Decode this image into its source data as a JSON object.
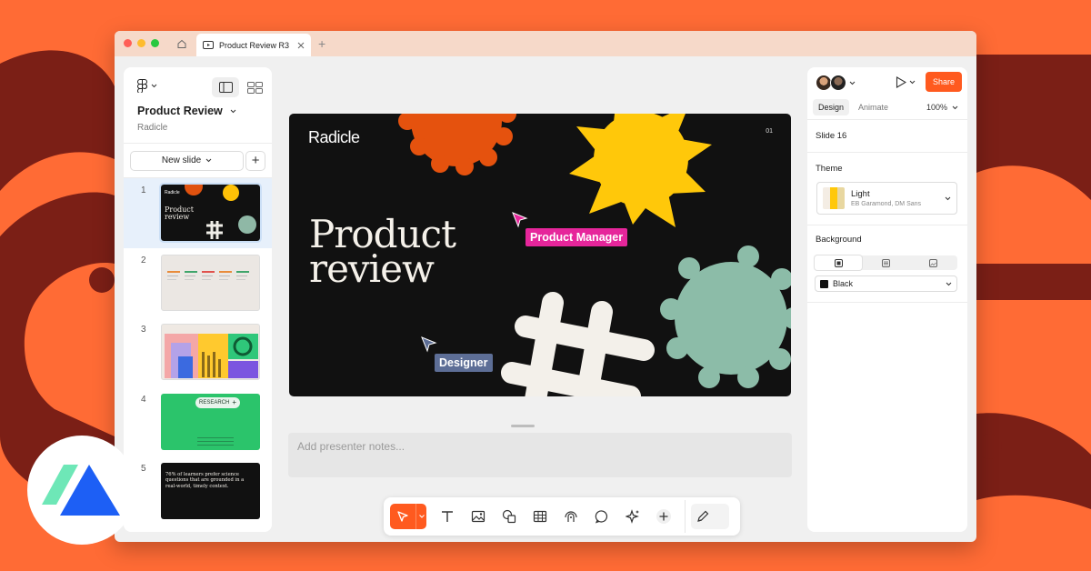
{
  "colors": {
    "background": "#ff6b35",
    "background_shape": "#7b1f16",
    "accent": "#ff5a1f",
    "slide_bg": "#111111",
    "label_product_manager": "#e6269b",
    "label_designer": "#5d6e96"
  },
  "browser": {
    "tab_title": "Product Review R3",
    "tab_icon": "slides-icon",
    "new_tab_label": "+"
  },
  "left_panel": {
    "file_title": "Product Review",
    "file_subtitle": "Radicle",
    "new_slide_label": "New slide",
    "add_label": "+",
    "slides": [
      {
        "number": "1",
        "selected": true
      },
      {
        "number": "2",
        "selected": false
      },
      {
        "number": "3",
        "selected": false
      },
      {
        "number": "4",
        "selected": false,
        "tag": "RESEARCH"
      },
      {
        "number": "5",
        "selected": false,
        "text": "76% of learners prefer science questions that are grounded in a real-world, timely context."
      }
    ]
  },
  "slide": {
    "brand": "Radicle",
    "page_indicator": "01",
    "title_line1": "Product",
    "title_line2": "review",
    "cursors": [
      {
        "label": "Product Manager"
      },
      {
        "label": "Designer"
      }
    ]
  },
  "notes": {
    "placeholder": "Add presenter notes..."
  },
  "toolbar": {
    "tools": [
      "select-tool",
      "text-tool",
      "image-tool",
      "shape-tool",
      "table-tool",
      "stamp-tool",
      "comment-tool",
      "ai-tool",
      "add-tool",
      "sketch-tool"
    ]
  },
  "right_panel": {
    "share_label": "Share",
    "tabs": [
      "Design",
      "Animate"
    ],
    "zoom": "100%",
    "slide_label": "Slide 16",
    "theme_heading": "Theme",
    "theme_name": "Light",
    "theme_fonts": "EB Garamond, DM Sans",
    "background_heading": "Background",
    "background_value": "Black"
  }
}
